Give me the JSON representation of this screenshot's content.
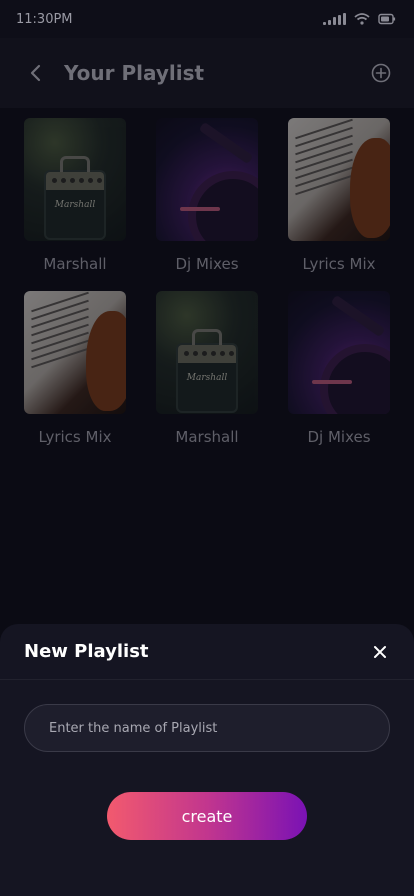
{
  "status_bar": {
    "time": "11:30PM"
  },
  "header": {
    "title": "Your Playlist",
    "back_icon": "chevron-left-icon",
    "add_icon": "plus-circle-icon"
  },
  "playlists": [
    {
      "label": "Marshall",
      "art": "amplifier"
    },
    {
      "label": "Dj Mixes",
      "art": "dj-turntable"
    },
    {
      "label": "Lyrics Mix",
      "art": "violin-sheet-music"
    },
    {
      "label": "Lyrics Mix",
      "art": "violin-sheet-music"
    },
    {
      "label": "Marshall",
      "art": "amplifier"
    },
    {
      "label": "Dj Mixes",
      "art": "dj-turntable"
    }
  ],
  "new_playlist_sheet": {
    "title": "New Playlist",
    "name_input": {
      "value": "",
      "placeholder": "Enter the name of Playlist"
    },
    "create_label": "create",
    "close_icon": "close-icon"
  },
  "colors": {
    "background": "#0b0b14",
    "sheet_background": "#151522",
    "gradient_start": "#f25a6e",
    "gradient_end": "#7a12b4"
  }
}
